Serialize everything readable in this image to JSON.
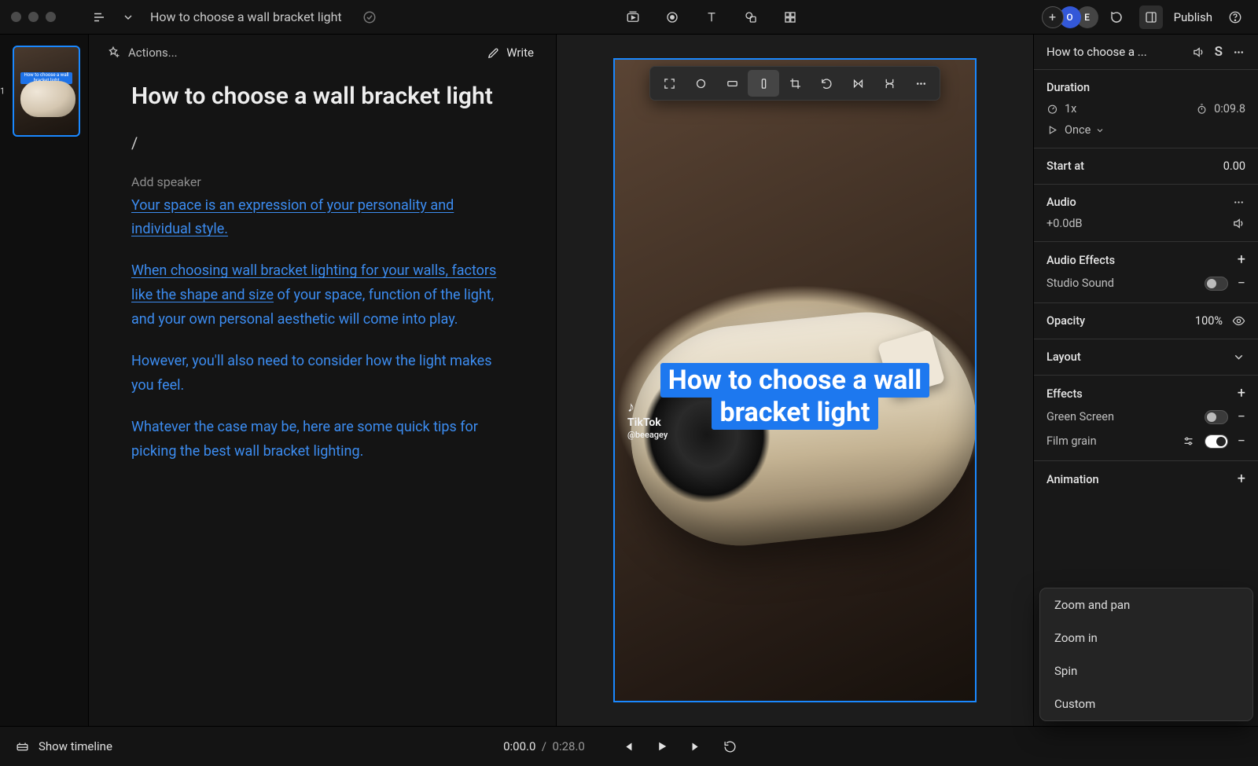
{
  "top": {
    "title": "How to choose a wall bracket light",
    "publish": "Publish",
    "avatars": [
      "O",
      "E"
    ]
  },
  "rail": {
    "scenes": [
      {
        "index": "1",
        "caption": "How to choose a wall bracket light"
      }
    ]
  },
  "script": {
    "actions": "Actions...",
    "write": "Write",
    "title": "How to choose a wall bracket light",
    "slash": "/",
    "add_speaker": "Add speaker",
    "p1": {
      "link": "Your space is an expression of your personality and individual style."
    },
    "p2": {
      "link": "When choosing wall bracket lighting for your walls, factors like the shape and size",
      "rest": " of your space, function of the light, and your own personal aesthetic will come into play."
    },
    "p3": "However, you'll also need to consider how the light makes you feel.",
    "p4": "Whatever the case may be, here are some quick tips for picking the best wall bracket lighting."
  },
  "canvas": {
    "overlay": "How to choose a wall bracket light",
    "watermark_brand": "TikTok",
    "watermark_handle": "@beeagey"
  },
  "inspector": {
    "title": "How to choose a ...",
    "duration": {
      "label": "Duration",
      "speed": "1x",
      "time": "0:09.8",
      "loop": "Once"
    },
    "start_at": {
      "label": "Start at",
      "value": "0.00"
    },
    "audio": {
      "label": "Audio",
      "gain": "+0.0dB"
    },
    "audio_effects": {
      "label": "Audio Effects",
      "studio_sound": "Studio Sound"
    },
    "opacity": {
      "label": "Opacity",
      "value": "100%"
    },
    "layout": {
      "label": "Layout"
    },
    "effects": {
      "label": "Effects",
      "green_screen": "Green Screen",
      "film_grain": "Film grain"
    },
    "animation": {
      "label": "Animation"
    },
    "popover": [
      "Zoom and pan",
      "Zoom in",
      "Spin",
      "Custom"
    ]
  },
  "footer": {
    "show_timeline": "Show timeline",
    "current": "0:00.0",
    "total": "0:28.0"
  }
}
